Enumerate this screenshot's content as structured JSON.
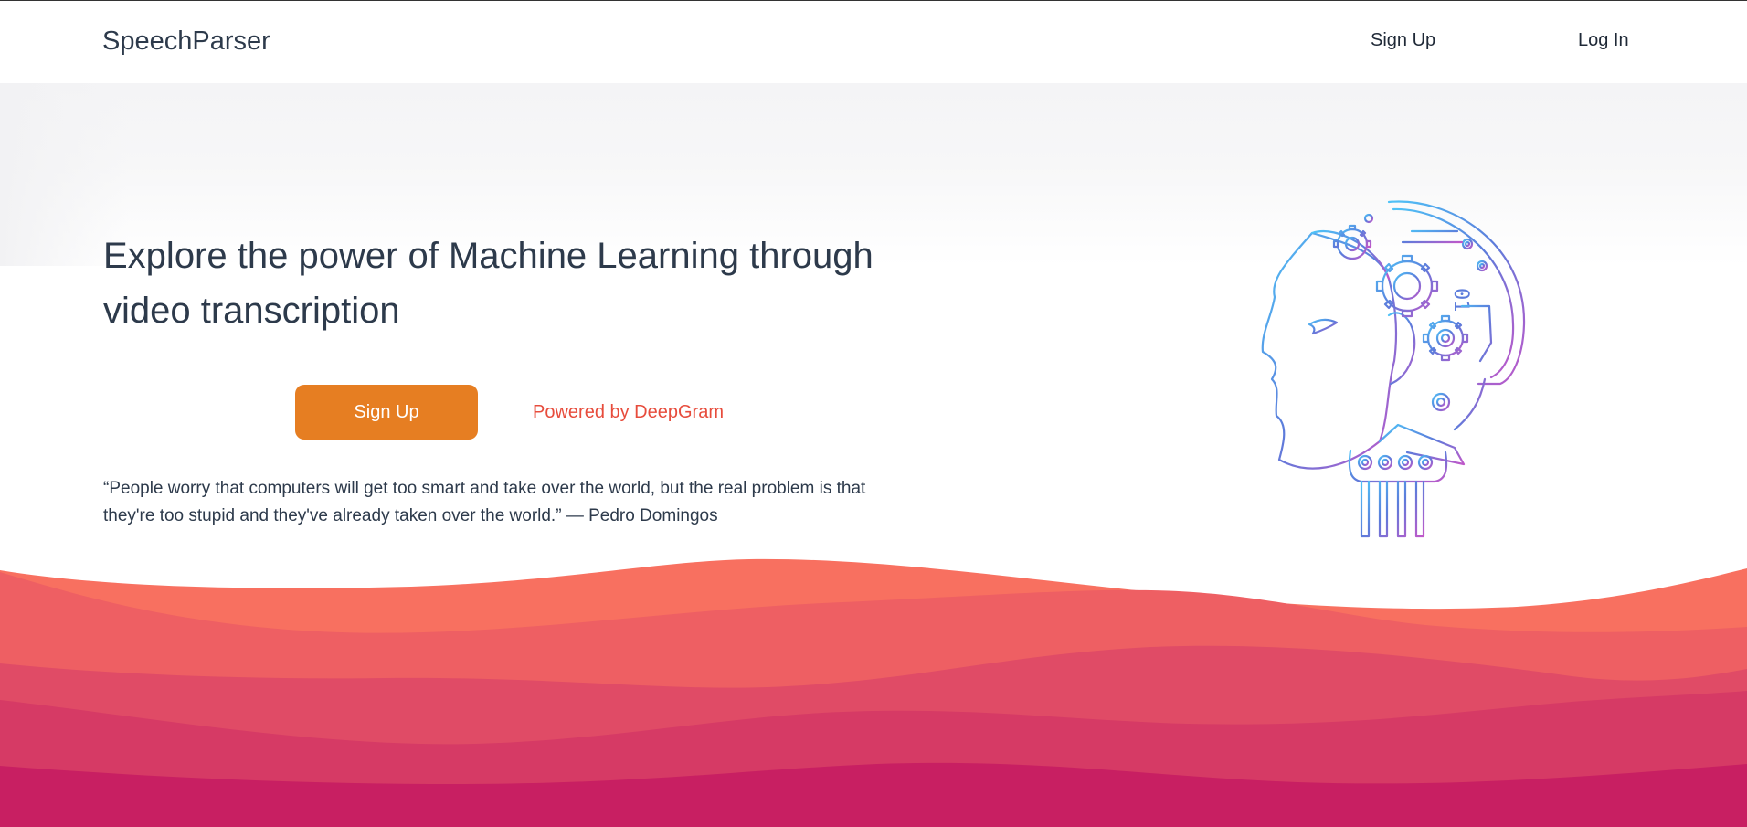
{
  "nav": {
    "brand": "SpeechParser",
    "signup_label": "Sign Up",
    "login_label": "Log In"
  },
  "hero": {
    "title": "Explore the power of Machine Learning through video transcription",
    "cta_label": "Sign Up",
    "powered_by": "Powered by DeepGram",
    "quote": "“People worry that computers will get too smart and take over the world, but the real problem is that they're too stupid and they've already taken over the world.” — Pedro Domingos"
  },
  "colors": {
    "text_dark": "#2d3a4b",
    "cta": "#e67e22",
    "link_accent": "#e74c3c",
    "wave_1": "#f87060",
    "wave_2": "#ee5f63",
    "wave_3": "#e04b66",
    "wave_4": "#d63a65",
    "wave_5": "#c81f62",
    "robot_gradient_start": "#4fc3f7",
    "robot_gradient_mid": "#5c7cdb",
    "robot_gradient_end": "#c058c9"
  },
  "illustration": {
    "icon": "robot-head-gears-icon"
  }
}
